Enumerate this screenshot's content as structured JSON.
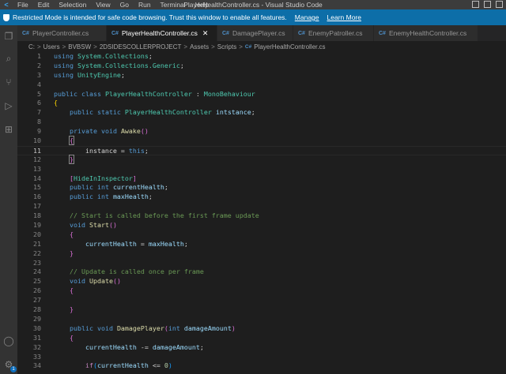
{
  "titlebar": {
    "logo": "<",
    "menus": [
      "File",
      "Edit",
      "Selection",
      "View",
      "Go",
      "Run",
      "Terminal",
      "Help"
    ],
    "title": "PlayerHealthController.cs - Visual Studio Code"
  },
  "banner": {
    "message": "Restricted Mode is intended for safe code browsing. Trust this window to enable all features.",
    "manage": "Manage",
    "learn_more": "Learn More"
  },
  "activity": {
    "explorer": "❐",
    "search": "⌕",
    "source_control": "⑂",
    "run": "▷",
    "extensions": "⊞",
    "account": "◯",
    "settings": "⚙",
    "settings_badge": "1"
  },
  "tabs": [
    {
      "icon": "C#",
      "label": "PlayerController.cs"
    },
    {
      "icon": "C#",
      "label": "PlayerHealthController.cs",
      "close": "✕"
    },
    {
      "icon": "C#",
      "label": "DamagePlayer.cs"
    },
    {
      "icon": "C#",
      "label": "EnemyPatroller.cs"
    },
    {
      "icon": "C#",
      "label": "EnemyHealthController.cs"
    }
  ],
  "breadcrumb": {
    "parts": [
      "C:",
      "Users",
      "BVBSW",
      "2DSIDESCOLLERPROJECT",
      "Assets",
      "Scripts"
    ],
    "sep": ">",
    "file_icon": "C#",
    "file": "PlayerHealthController.cs"
  },
  "editor": {
    "line_numbers": [
      "1",
      "2",
      "3",
      "4",
      "5",
      "6",
      "7",
      "8",
      "9",
      "10",
      "11",
      "12",
      "13",
      "14",
      "15",
      "16",
      "17",
      "18",
      "19",
      "20",
      "21",
      "22",
      "23",
      "24",
      "25",
      "26",
      "27",
      "28",
      "29",
      "30",
      "31",
      "32",
      "33",
      "34"
    ],
    "current_line": 11,
    "lines": [
      [
        {
          "t": "using ",
          "c": "kw"
        },
        {
          "t": "System.Collections",
          "c": "ty"
        },
        {
          "t": ";",
          "c": "pl"
        }
      ],
      [
        {
          "t": "using ",
          "c": "kw"
        },
        {
          "t": "System.Collections.Generic",
          "c": "ty"
        },
        {
          "t": ";",
          "c": "pl"
        }
      ],
      [
        {
          "t": "using ",
          "c": "kw"
        },
        {
          "t": "UnityEngine",
          "c": "ty"
        },
        {
          "t": ";",
          "c": "pl"
        }
      ],
      [],
      [
        {
          "t": "public ",
          "c": "kw"
        },
        {
          "t": "class ",
          "c": "kw"
        },
        {
          "t": "PlayerHealthController",
          "c": "ty"
        },
        {
          "t": " : ",
          "c": "pl"
        },
        {
          "t": "MonoBehaviour",
          "c": "ty"
        }
      ],
      [
        {
          "t": "{",
          "c": "br1"
        }
      ],
      [
        {
          "t": "    public ",
          "c": "kw"
        },
        {
          "t": "static ",
          "c": "kw"
        },
        {
          "t": "PlayerHealthController",
          "c": "ty"
        },
        {
          "t": " ",
          "c": "pl"
        },
        {
          "t": "intstance",
          "c": "vr"
        },
        {
          "t": ";",
          "c": "pl"
        }
      ],
      [],
      [
        {
          "t": "    private ",
          "c": "kw"
        },
        {
          "t": "void ",
          "c": "kw"
        },
        {
          "t": "Awake",
          "c": "fn"
        },
        {
          "t": "()",
          "c": "br2"
        }
      ],
      [
        {
          "t": "    ",
          "c": "pl"
        },
        {
          "t": "{",
          "c": "br2 bx"
        }
      ],
      [
        {
          "t": "        instance = ",
          "c": "pl"
        },
        {
          "t": "this",
          "c": "kw"
        },
        {
          "t": ";",
          "c": "pl"
        }
      ],
      [
        {
          "t": "    ",
          "c": "pl"
        },
        {
          "t": "}",
          "c": "br2 bx"
        }
      ],
      [],
      [
        {
          "t": "    [",
          "c": "br2"
        },
        {
          "t": "HideInInspector",
          "c": "ty"
        },
        {
          "t": "]",
          "c": "br2"
        }
      ],
      [
        {
          "t": "    public ",
          "c": "kw"
        },
        {
          "t": "int ",
          "c": "kw"
        },
        {
          "t": "currentHealth",
          "c": "vr"
        },
        {
          "t": ";",
          "c": "pl"
        }
      ],
      [
        {
          "t": "    public ",
          "c": "kw"
        },
        {
          "t": "int ",
          "c": "kw"
        },
        {
          "t": "maxHealth",
          "c": "vr"
        },
        {
          "t": ";",
          "c": "pl"
        }
      ],
      [],
      [
        {
          "t": "    // Start is called before the first frame update",
          "c": "cm"
        }
      ],
      [
        {
          "t": "    void ",
          "c": "kw"
        },
        {
          "t": "Start",
          "c": "fn"
        },
        {
          "t": "()",
          "c": "br2"
        }
      ],
      [
        {
          "t": "    {",
          "c": "br2"
        }
      ],
      [
        {
          "t": "        currentHealth",
          "c": "vr"
        },
        {
          "t": " = ",
          "c": "pl"
        },
        {
          "t": "maxHealth",
          "c": "vr"
        },
        {
          "t": ";",
          "c": "pl"
        }
      ],
      [
        {
          "t": "    }",
          "c": "br2"
        }
      ],
      [],
      [
        {
          "t": "    // Update is called once per frame",
          "c": "cm"
        }
      ],
      [
        {
          "t": "    void ",
          "c": "kw"
        },
        {
          "t": "Update",
          "c": "fn"
        },
        {
          "t": "()",
          "c": "br2"
        }
      ],
      [
        {
          "t": "    {",
          "c": "br2"
        }
      ],
      [],
      [
        {
          "t": "    }",
          "c": "br2"
        }
      ],
      [],
      [
        {
          "t": "    public ",
          "c": "kw"
        },
        {
          "t": "void ",
          "c": "kw"
        },
        {
          "t": "DamagePlayer",
          "c": "fn"
        },
        {
          "t": "(",
          "c": "br2"
        },
        {
          "t": "int ",
          "c": "kw"
        },
        {
          "t": "damageAmount",
          "c": "vr"
        },
        {
          "t": ")",
          "c": "br2"
        }
      ],
      [
        {
          "t": "    {",
          "c": "br2"
        }
      ],
      [
        {
          "t": "        currentHealth",
          "c": "vr"
        },
        {
          "t": " -= ",
          "c": "pl"
        },
        {
          "t": "damageAmount",
          "c": "vr"
        },
        {
          "t": ";",
          "c": "pl"
        }
      ],
      [],
      [
        {
          "t": "        ",
          "c": "pl"
        },
        {
          "t": "if",
          "c": "ctl"
        },
        {
          "t": "(",
          "c": "br3"
        },
        {
          "t": "currentHealth",
          "c": "vr"
        },
        {
          "t": " <= ",
          "c": "pl"
        },
        {
          "t": "0",
          "c": "num"
        },
        {
          "t": ")",
          "c": "br3"
        }
      ]
    ]
  }
}
